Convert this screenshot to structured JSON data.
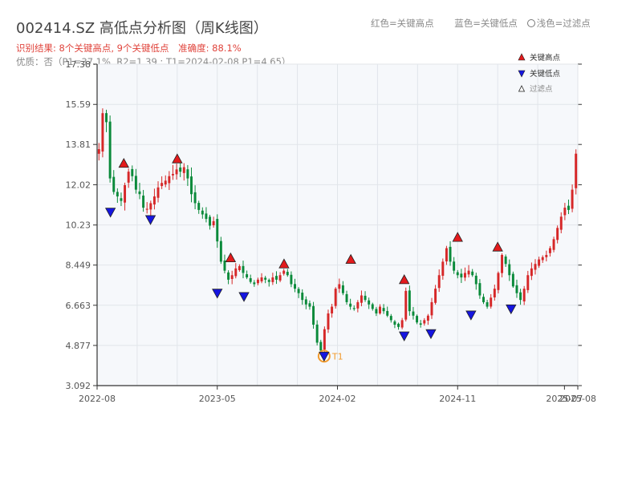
{
  "title": "002414.SZ 高低点分析图（周K线图）",
  "summary": {
    "result": "识别结果: 8个关键高点, 9个关键低点",
    "accuracy": "准确度: 88.1%"
  },
  "quality_line": "优质：否（P1=37.1%, R2=1.39 ; T1=2024-02-08 P1=4.65）",
  "color_legend": {
    "red": "红色=关键高点",
    "blue": "蓝色=关键低点",
    "light": "浅色=过滤点"
  },
  "colors": {
    "up": "#d62728",
    "down": "#0a8a3a",
    "high_marker": "#e31a1c",
    "low_marker": "#1515e0",
    "t1_ring": "#f29b2e",
    "plot_bg": "#f6f8fb",
    "grid": "#e1e5ea"
  },
  "chart_data": {
    "type": "candlestick",
    "title": "002414.SZ 高低点分析图（周K线图）",
    "xlabel": "",
    "ylabel": "",
    "ylim": [
      3.092,
      17.38
    ],
    "y_ticks": [
      "3.092",
      "4.877",
      "6.663",
      "8.449",
      "10.23",
      "12.02",
      "13.81",
      "15.59",
      "17.38"
    ],
    "x_ticks": [
      "2022-08",
      "2023-05",
      "2024-02",
      "2024-11",
      "2025-07",
      "2025-08"
    ],
    "x_range": [
      "2022-08",
      "2025-08"
    ],
    "legend": {
      "position": "top-right",
      "entries": [
        "关键高点",
        "关键低点",
        "过滤点"
      ]
    },
    "grid": true,
    "weekly_close": [
      13.6,
      15.2,
      14.8,
      12.3,
      11.7,
      11.5,
      11.3,
      12.0,
      12.6,
      12.4,
      11.8,
      11.6,
      11.0,
      10.95,
      11.2,
      11.5,
      11.9,
      12.1,
      12.2,
      12.4,
      12.5,
      12.7,
      12.6,
      12.8,
      12.3,
      11.6,
      11.2,
      10.9,
      10.7,
      10.5,
      10.2,
      10.4,
      9.5,
      8.6,
      8.2,
      7.8,
      8.0,
      8.3,
      8.4,
      8.1,
      7.9,
      7.7,
      7.6,
      7.8,
      7.9,
      7.8,
      7.7,
      7.9,
      7.8,
      8.0,
      8.2,
      8.0,
      7.6,
      7.4,
      7.2,
      6.9,
      6.7,
      6.6,
      5.8,
      5.0,
      4.65,
      5.6,
      6.3,
      6.6,
      7.4,
      7.6,
      7.2,
      6.8,
      6.6,
      6.5,
      6.8,
      7.1,
      6.9,
      6.7,
      6.5,
      6.3,
      6.6,
      6.4,
      6.2,
      6.0,
      5.8,
      5.7,
      6.0,
      7.3,
      6.4,
      6.2,
      5.9,
      5.8,
      6.0,
      6.2,
      6.8,
      7.4,
      8.0,
      8.6,
      9.2,
      8.6,
      8.2,
      8.0,
      7.9,
      8.1,
      8.2,
      8.0,
      7.6,
      7.1,
      6.8,
      6.6,
      7.0,
      7.4,
      8.1,
      8.9,
      8.5,
      8.0,
      7.5,
      7.2,
      6.9,
      7.4,
      8.0,
      8.3,
      8.5,
      8.7,
      8.8,
      8.9,
      9.2,
      9.6,
      10.1,
      10.6,
      11.0,
      10.9,
      11.8,
      13.4
    ],
    "key_highs": [
      {
        "date": "2022-10",
        "value": 12.72
      },
      {
        "date": "2023-02",
        "value": 12.92
      },
      {
        "date": "2023-06",
        "value": 8.52
      },
      {
        "date": "2023-10",
        "value": 8.25
      },
      {
        "date": "2024-03",
        "value": 8.45
      },
      {
        "date": "2024-07",
        "value": 7.55
      },
      {
        "date": "2024-11",
        "value": 9.43
      },
      {
        "date": "2025-02",
        "value": 9.0
      }
    ],
    "key_lows": [
      {
        "date": "2022-09",
        "value": 11.05
      },
      {
        "date": "2022-12",
        "value": 10.72
      },
      {
        "date": "2023-05",
        "value": 7.45
      },
      {
        "date": "2023-07",
        "value": 7.3
      },
      {
        "date": "2024-01",
        "value": 4.65,
        "label": "T1"
      },
      {
        "date": "2024-07",
        "value": 5.55
      },
      {
        "date": "2024-09",
        "value": 5.65
      },
      {
        "date": "2024-12",
        "value": 6.48
      },
      {
        "date": "2025-03",
        "value": 6.75
      }
    ],
    "annotations": [
      "T1"
    ]
  }
}
